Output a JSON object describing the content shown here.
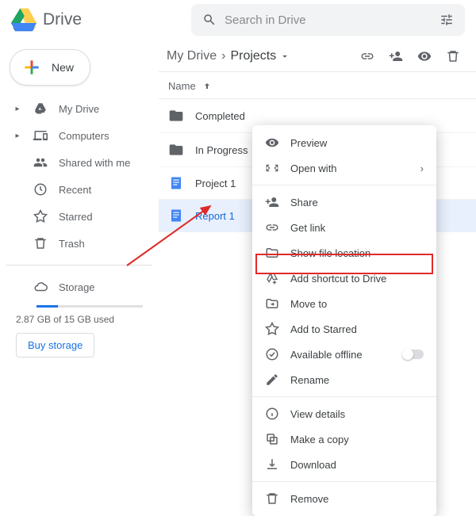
{
  "app": {
    "name": "Drive"
  },
  "search": {
    "placeholder": "Search in Drive"
  },
  "new_button": {
    "label": "New"
  },
  "sidebar": {
    "items": [
      {
        "label": "My Drive",
        "icon": "drive-icon",
        "expandable": true
      },
      {
        "label": "Computers",
        "icon": "devices-icon",
        "expandable": true
      },
      {
        "label": "Shared with me",
        "icon": "people-icon",
        "expandable": false
      },
      {
        "label": "Recent",
        "icon": "clock-icon",
        "expandable": false
      },
      {
        "label": "Starred",
        "icon": "star-icon",
        "expandable": false
      },
      {
        "label": "Trash",
        "icon": "trash-icon",
        "expandable": false
      }
    ],
    "storage_label": "Storage",
    "storage_used": "2.87 GB of 15 GB used",
    "buy": "Buy storage"
  },
  "breadcrumb": {
    "root": "My Drive",
    "current": "Projects"
  },
  "list": {
    "header": "Name",
    "rows": [
      {
        "name": "Completed",
        "type": "folder"
      },
      {
        "name": "In Progress",
        "type": "folder"
      },
      {
        "name": "Project 1",
        "type": "doc"
      },
      {
        "name": "Report 1",
        "type": "doc",
        "selected": true
      }
    ]
  },
  "context_menu": {
    "groups": [
      [
        {
          "label": "Preview",
          "icon": "eye-icon"
        },
        {
          "label": "Open with",
          "icon": "openwith-icon",
          "submenu": true
        }
      ],
      [
        {
          "label": "Share",
          "icon": "person-add-icon"
        },
        {
          "label": "Get link",
          "icon": "link-icon"
        },
        {
          "label": "Show file location",
          "icon": "folder-outline-icon"
        },
        {
          "label": "Add shortcut to Drive",
          "icon": "add-drive-icon"
        },
        {
          "label": "Move to",
          "icon": "move-icon",
          "highlighted": true
        },
        {
          "label": "Add to Starred",
          "icon": "star-icon"
        },
        {
          "label": "Available offline",
          "icon": "offline-icon",
          "toggle": true
        },
        {
          "label": "Rename",
          "icon": "rename-icon"
        }
      ],
      [
        {
          "label": "View details",
          "icon": "info-icon"
        },
        {
          "label": "Make a copy",
          "icon": "copy-icon"
        },
        {
          "label": "Download",
          "icon": "download-icon"
        }
      ],
      [
        {
          "label": "Remove",
          "icon": "trash-icon"
        }
      ]
    ]
  },
  "annotation": {
    "highlighted_item": "Move to"
  }
}
